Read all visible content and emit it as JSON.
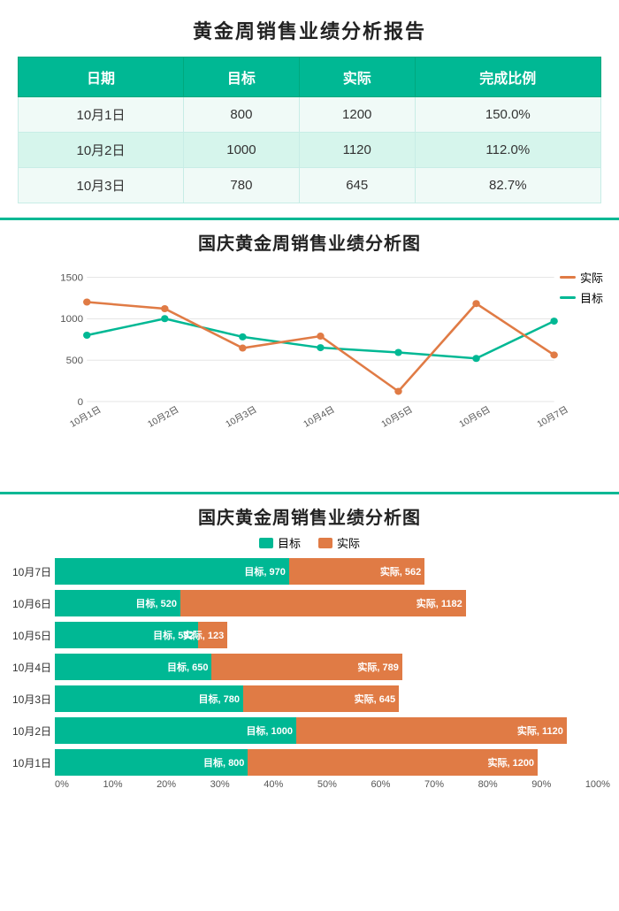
{
  "title": "黄金周销售业绩分析报告",
  "table": {
    "headers": [
      "日期",
      "目标",
      "实际",
      "完成比例"
    ],
    "rows": [
      [
        "10月1日",
        "800",
        "1200",
        "150.0%"
      ],
      [
        "10月2日",
        "1000",
        "1120",
        "112.0%"
      ],
      [
        "10月3日",
        "780",
        "645",
        "82.7%"
      ]
    ]
  },
  "lineChart": {
    "title": "国庆黄金周销售业绩分析图",
    "yLabels": [
      "0",
      "500",
      "1000",
      "1500"
    ],
    "xLabels": [
      "10月1日",
      "10月2日",
      "10月3日",
      "10月4日",
      "10月5日",
      "10月6日",
      "10月7日"
    ],
    "targetData": [
      800,
      1000,
      780,
      650,
      592,
      520,
      970
    ],
    "actualData": [
      1200,
      1120,
      645,
      789,
      123,
      1182,
      562
    ],
    "legend": {
      "actual": "实际",
      "target": "目标"
    },
    "colors": {
      "target": "#00b894",
      "actual": "#e07b45"
    }
  },
  "barChart": {
    "title": "国庆黄金周销售业绩分析图",
    "legend": {
      "target": "目标",
      "actual": "实际"
    },
    "rows": [
      {
        "label": "10月7日",
        "target": 970,
        "actual": 562
      },
      {
        "label": "10月6日",
        "target": 520,
        "actual": 1182
      },
      {
        "label": "10月5日",
        "target": 592,
        "actual": 123
      },
      {
        "label": "10月4日",
        "target": 650,
        "actual": 789
      },
      {
        "label": "10月3日",
        "target": 780,
        "actual": 645
      },
      {
        "label": "10月2日",
        "target": 1000,
        "actual": 1120
      },
      {
        "label": "10月1日",
        "target": 800,
        "actual": 1200
      }
    ],
    "xAxisLabels": [
      "0%",
      "10%",
      "20%",
      "30%",
      "40%",
      "50%",
      "60%",
      "70%",
      "80%",
      "90%",
      "100%"
    ],
    "maxValue": 2300,
    "colors": {
      "target": "#00b894",
      "actual": "#e07b45"
    }
  }
}
